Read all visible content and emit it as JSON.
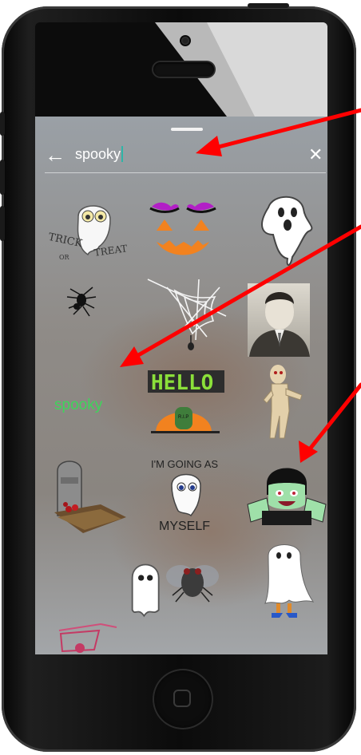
{
  "search": {
    "query": "spooky"
  },
  "icons": {
    "back": "←",
    "clear": "✕"
  },
  "stickers": {
    "trick_or_treat": [
      "TRICK",
      "OR",
      "TREAT"
    ],
    "hello": "HELLO",
    "spooky_text": "spooky",
    "going_as": [
      "I'M GOING AS",
      "MYSELF"
    ],
    "grave_text": "R.I.P"
  },
  "colors": {
    "accent_caret": "#2fb5a7",
    "annotation_arrow": "#ff0000",
    "spooky_text": "#3dd65a",
    "hello_text": "#8be03a"
  }
}
